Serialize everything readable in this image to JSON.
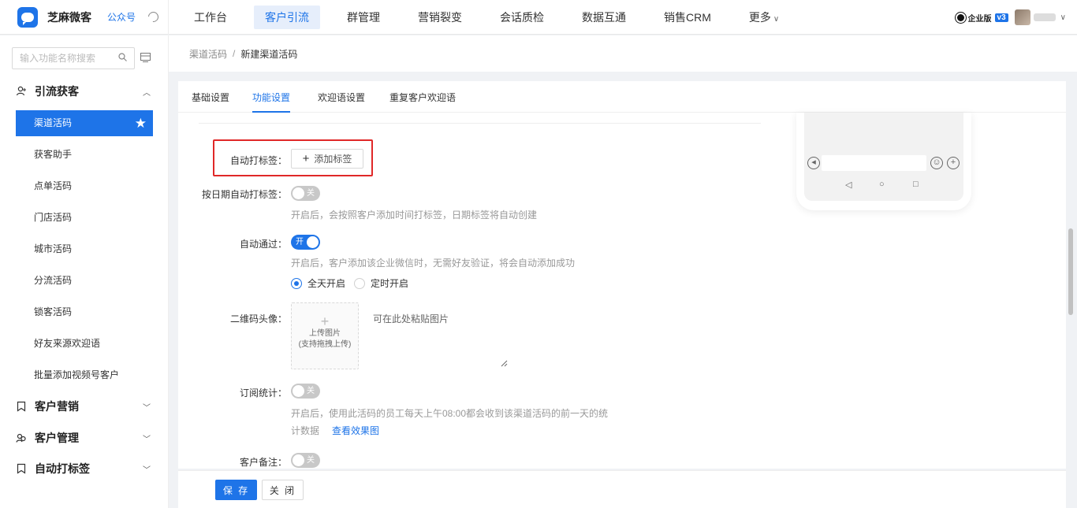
{
  "topbar": {
    "brand_name": "芝麻微客",
    "brand_link": "公众号",
    "nav": [
      {
        "label": "工作台"
      },
      {
        "label": "客户引流",
        "active": true
      },
      {
        "label": "群管理"
      },
      {
        "label": "营销裂变"
      },
      {
        "label": "会话质检"
      },
      {
        "label": "数据互通"
      },
      {
        "label": "销售CRM"
      },
      {
        "label": "更多"
      }
    ],
    "enterprise_badge": "企业版",
    "version": "v3"
  },
  "sidebar": {
    "search_placeholder": "输入功能名称搜索",
    "groups": [
      {
        "label": "引流获客",
        "expanded": true,
        "items": [
          {
            "label": "渠道活码",
            "active": true
          },
          {
            "label": "获客助手"
          },
          {
            "label": "点单活码"
          },
          {
            "label": "门店活码"
          },
          {
            "label": "城市活码"
          },
          {
            "label": "分流活码"
          },
          {
            "label": "锁客活码"
          },
          {
            "label": "好友来源欢迎语"
          },
          {
            "label": "批量添加视频号客户"
          }
        ]
      },
      {
        "label": "客户营销",
        "expanded": false
      },
      {
        "label": "客户管理",
        "expanded": false
      },
      {
        "label": "自动打标签",
        "expanded": false
      }
    ]
  },
  "breadcrumb": {
    "parent": "渠道活码",
    "separator": "/",
    "current": "新建渠道活码"
  },
  "tabs": [
    {
      "label": "基础设置"
    },
    {
      "label": "功能设置",
      "active": true
    },
    {
      "label": "欢迎语设置"
    },
    {
      "label": "重复客户欢迎语"
    }
  ],
  "form": {
    "auto_tag": {
      "label": "自动打标签：",
      "button": "添加标签"
    },
    "date_tag": {
      "label": "按日期自动打标签：",
      "switch": "关",
      "on": false,
      "help": "开启后，会按照客户添加时间打标签，日期标签将自动创建"
    },
    "auto_pass": {
      "label": "自动通过：",
      "switch": "开",
      "on": true,
      "help": "开启后，客户添加该企业微信时，无需好友验证，将会自动添加成功",
      "options": [
        {
          "label": "全天开启",
          "checked": true
        },
        {
          "label": "定时开启",
          "checked": false
        }
      ]
    },
    "qr_avatar": {
      "label": "二维码头像：",
      "upload_line1": "上传图片",
      "upload_line2": "(支持拖拽上传)",
      "paste_hint": "可在此处粘贴图片"
    },
    "subscription": {
      "label": "订阅统计：",
      "switch": "关",
      "on": false,
      "help_line1": "开启后，使用此活码的员工每天上午08:00都会收到该渠道活码的前一天的统",
      "help_line2": "计数据",
      "link": "查看效果图"
    },
    "remark": {
      "label": "客户备注：",
      "switch": "关",
      "on": false
    }
  },
  "footer": {
    "save": "保 存",
    "close": "关 闭"
  },
  "colors": {
    "primary": "#1e74e8",
    "highlight_border": "#e02828"
  }
}
